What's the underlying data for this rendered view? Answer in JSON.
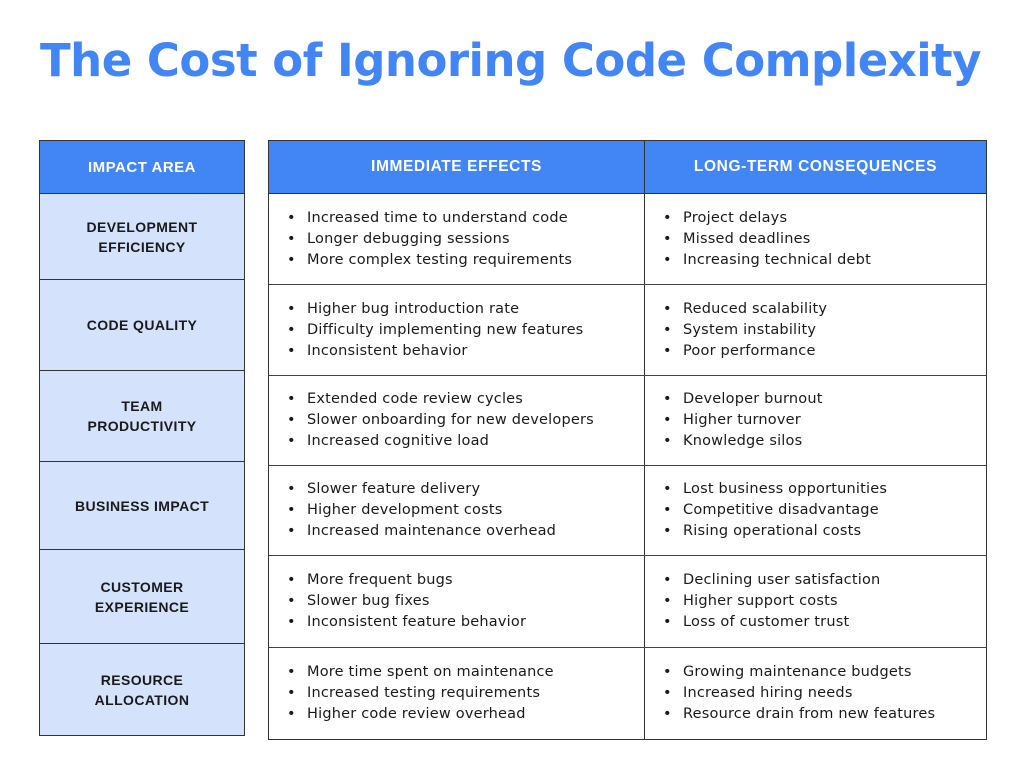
{
  "title": "The Cost of Ignoring Code Complexity",
  "colors": {
    "accent": "#4285f4",
    "area_bg": "#d4e2fb"
  },
  "headers": {
    "impact_area": "IMPACT AREA",
    "immediate": "IMMEDIATE EFFECTS",
    "long_term": "LONG-TERM CONSEQUENCES"
  },
  "rows": [
    {
      "area": "DEVELOPMENT EFFICIENCY",
      "immediate": [
        "Increased time to understand code",
        "Longer debugging sessions",
        "More complex testing requirements"
      ],
      "long_term": [
        "Project delays",
        "Missed deadlines",
        "Increasing technical debt"
      ]
    },
    {
      "area": "CODE QUALITY",
      "immediate": [
        "Higher bug introduction rate",
        "Difficulty implementing new features",
        "Inconsistent behavior"
      ],
      "long_term": [
        "Reduced scalability",
        "System instability",
        "Poor performance"
      ]
    },
    {
      "area": "TEAM PRODUCTIVITY",
      "immediate": [
        "Extended code review cycles",
        "Slower onboarding for new developers",
        "Increased cognitive load"
      ],
      "long_term": [
        "Developer burnout",
        "Higher turnover",
        "Knowledge silos"
      ]
    },
    {
      "area": "BUSINESS IMPACT",
      "immediate": [
        "Slower feature delivery",
        "Higher development costs",
        "Increased maintenance overhead"
      ],
      "long_term": [
        "Lost business opportunities",
        "Competitive disadvantage",
        "Rising operational costs"
      ]
    },
    {
      "area": "CUSTOMER EXPERIENCE",
      "immediate": [
        "More frequent bugs",
        "Slower bug fixes",
        "Inconsistent feature behavior"
      ],
      "long_term": [
        "Declining user satisfaction",
        "Higher support costs",
        "Loss of customer trust"
      ]
    },
    {
      "area": "RESOURCE ALLOCATION",
      "immediate": [
        "More time spent on maintenance",
        "Increased testing requirements",
        "Higher code review overhead"
      ],
      "long_term": [
        "Growing maintenance budgets",
        "Increased hiring needs",
        "Resource drain from new features"
      ]
    }
  ]
}
